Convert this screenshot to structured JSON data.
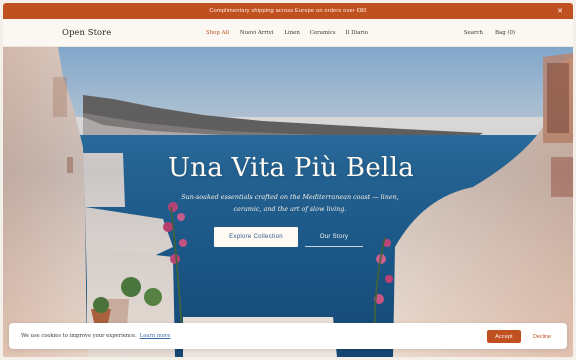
{
  "announcement": {
    "text": "Complimentary shipping across Europe on orders over €80",
    "close_icon": "close-icon"
  },
  "nav": {
    "logo": "Open Store",
    "items": [
      {
        "label": "Shop All",
        "active": true
      },
      {
        "label": "Nuovi Arrivi",
        "active": false
      },
      {
        "label": "Linen",
        "active": false
      },
      {
        "label": "Ceramics",
        "active": false
      },
      {
        "label": "Il Diario",
        "active": false
      }
    ],
    "search_label": "Search",
    "bag_label": "Bag (0)"
  },
  "hero": {
    "title": "Una Vita Più Bella",
    "subtitle": "Sun-soaked essentials crafted on the Mediterranean coast — linen, ceramic, and the art of slow living.",
    "primary_cta": "Explore Collection",
    "secondary_cta": "Our Story"
  },
  "cookie": {
    "text": "We use cookies to improve your experience.",
    "link": "Learn more",
    "accept": "Accept",
    "decline": "Decline"
  },
  "colors": {
    "accent": "#c0501f",
    "cream": "#fbf8f3",
    "sea": "#1f5e8c"
  }
}
